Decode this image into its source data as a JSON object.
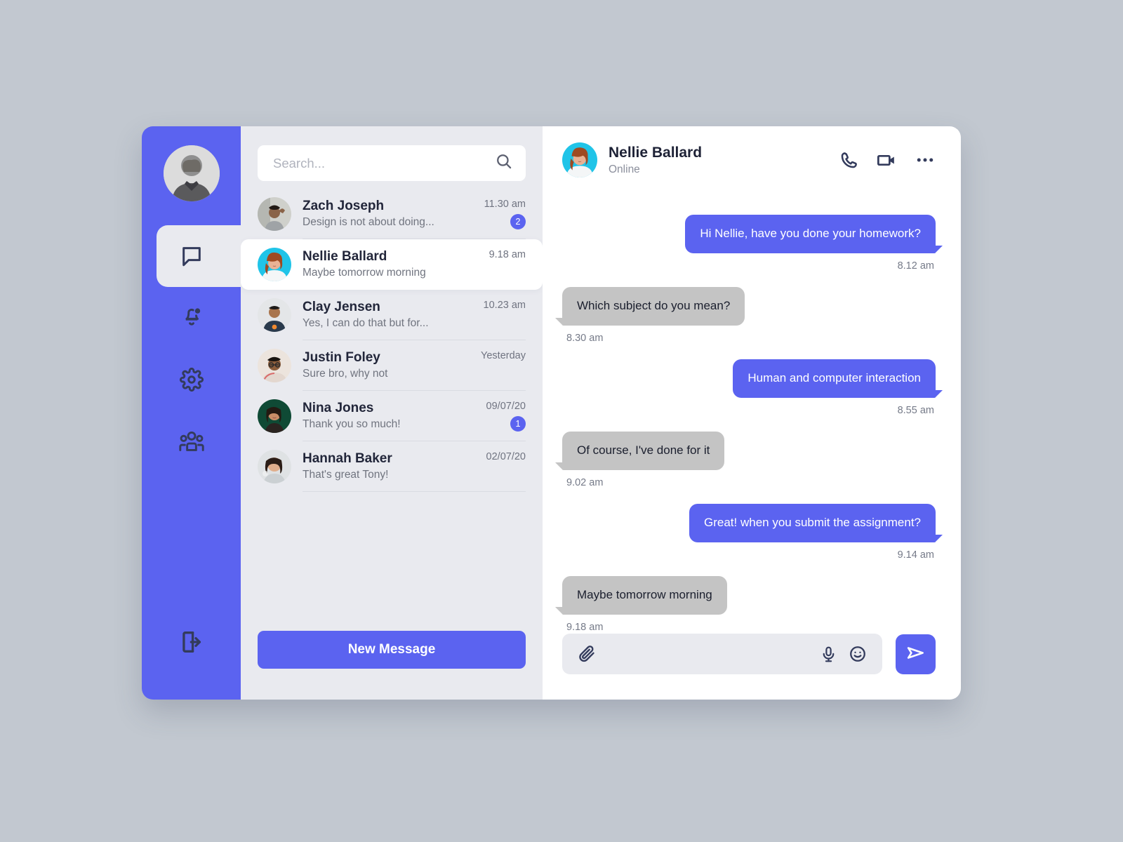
{
  "theme": {
    "accent": "#5b63f0",
    "panel_bg": "#e9eaef",
    "canvas_bg": "#c2c8d0",
    "incoming_bubble": "#c4c4c4",
    "dark_icon": "#333b5c"
  },
  "sidebar": {
    "profile_avatar_name": "user-profile-avatar",
    "items": [
      {
        "icon": "chat-bubble-icon",
        "label": "Chats",
        "active": true
      },
      {
        "icon": "bell-notification-icon",
        "label": "Notifications",
        "active": false
      },
      {
        "icon": "gear-icon",
        "label": "Settings",
        "active": false
      },
      {
        "icon": "people-group-icon",
        "label": "Contacts",
        "active": false
      }
    ],
    "logout": {
      "icon": "logout-icon",
      "label": "Log out"
    }
  },
  "search": {
    "placeholder": "Search...",
    "value": "",
    "icon": "search-icon"
  },
  "chat_list": {
    "rows": [
      {
        "name": "Zach Joseph",
        "preview": "Design is not about doing...",
        "time": "11.30 am",
        "unread": "2",
        "selected": false
      },
      {
        "name": "Nellie Ballard",
        "preview": "Maybe tomorrow morning",
        "time": "9.18 am",
        "unread": "",
        "selected": true
      },
      {
        "name": "Clay Jensen",
        "preview": "Yes, I can do that but for...",
        "time": "10.23 am",
        "unread": "",
        "selected": false
      },
      {
        "name": "Justin Foley",
        "preview": "Sure bro, why not",
        "time": "Yesterday",
        "unread": "",
        "selected": false
      },
      {
        "name": "Nina Jones",
        "preview": "Thank you so much!",
        "time": "09/07/20",
        "unread": "1",
        "selected": false
      },
      {
        "name": "Hannah Baker",
        "preview": "That's great Tony!",
        "time": "02/07/20",
        "unread": "",
        "selected": false
      }
    ]
  },
  "new_message_button": {
    "label": "New Message"
  },
  "conversation": {
    "peer_name": "Nellie Ballard",
    "peer_status": "Online",
    "actions": [
      {
        "icon": "phone-icon",
        "label": "Voice call"
      },
      {
        "icon": "video-camera-icon",
        "label": "Video call"
      },
      {
        "icon": "more-options-icon",
        "label": "More options"
      }
    ],
    "messages": [
      {
        "direction": "out",
        "text": "Hi Nellie, have you done your homework?",
        "time": "8.12 am"
      },
      {
        "direction": "in",
        "text": "Which subject do you mean?",
        "time": "8.30 am"
      },
      {
        "direction": "out",
        "text": "Human and computer interaction",
        "time": "8.55 am"
      },
      {
        "direction": "in",
        "text": "Of course, I've done for it",
        "time": "9.02 am"
      },
      {
        "direction": "out",
        "text": "Great! when you submit the assignment?",
        "time": "9.14 am"
      },
      {
        "direction": "in",
        "text": "Maybe tomorrow morning",
        "time": "9.18 am"
      }
    ]
  },
  "composer": {
    "placeholder": "",
    "value": "",
    "attach_icon": "paperclip-icon",
    "mic_icon": "microphone-icon",
    "emoji_icon": "emoji-smiley-icon",
    "send_icon": "send-icon"
  }
}
